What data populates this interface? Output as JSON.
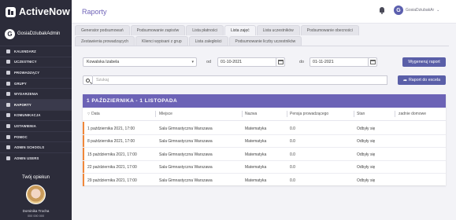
{
  "app": {
    "name": "ActiveNow"
  },
  "sidebar": {
    "user_name": "GosiaDziubakAdmin",
    "user_initial": "G",
    "items": [
      {
        "label": "KALENDARZ",
        "icon": "calendar-icon"
      },
      {
        "label": "UCZESTNICY",
        "icon": "user-icon"
      },
      {
        "label": "PROWADZĄCY",
        "icon": "user-icon"
      },
      {
        "label": "GRUPY",
        "icon": "users-icon"
      },
      {
        "label": "WYDARZENIA",
        "icon": "event-icon"
      },
      {
        "label": "RAPORTY",
        "icon": "chart-icon"
      },
      {
        "label": "KOMUNIKACJA",
        "icon": "message-icon"
      },
      {
        "label": "USTAWIENIA",
        "icon": "gear-icon"
      },
      {
        "label": "POMOC",
        "icon": "help-icon"
      },
      {
        "label": "ADMIN SCHOOLS",
        "icon": "school-icon"
      },
      {
        "label": "ADMIN USERS",
        "icon": "admin-icon"
      }
    ],
    "active_index": 5,
    "opiekun": {
      "title": "Twój opiekun",
      "name": "Dominika Trocha",
      "phone": "000 000 000"
    }
  },
  "header": {
    "title": "Raporty",
    "user_name": "GosiaDziubakAr",
    "user_initial": "G",
    "chevron": "⌄"
  },
  "tabs": {
    "row1": [
      "Generator podsumowań",
      "Podsumowanie zapisów",
      "Lista płatności",
      "Lista zajęć",
      "Lista uczestników",
      "Podsumowanie obecności"
    ],
    "row2": [
      "Zestawienia prowadzących",
      "Klienci wypisani z grup",
      "Lista zaległości",
      "Podsumowanie liczby uczestników"
    ],
    "active": "Lista zajęć"
  },
  "filters": {
    "instructor": "Kowalska Izabela",
    "from_label": "od",
    "from_date": "01-10-2021",
    "to_label": "do",
    "to_date": "01-11-2021",
    "generate_label": "Wygeneruj raport"
  },
  "search": {
    "placeholder": "Szukaj",
    "export_label": "Raport do excela"
  },
  "table": {
    "period": "1 PAŹDZIERNIKA - 1 LISTOPADA",
    "columns": [
      "Data",
      "Miejsce",
      "Nazwa",
      "Pensja prowadzącego",
      "Stan",
      "zadnie domowe"
    ],
    "rows": [
      {
        "date": "1 października 2021, 17:00",
        "place": "Sala Gimnastyczna Warszawa",
        "name": "Matematyka",
        "salary": "0.0",
        "status": "Odbyły się",
        "homework": ""
      },
      {
        "date": "8 października 2021, 17:00",
        "place": "Sala Gimnastyczna Warszawa",
        "name": "Matematyka",
        "salary": "0.0",
        "status": "Odbyły się",
        "homework": ""
      },
      {
        "date": "15 października 2021, 17:00",
        "place": "Sala Gimnastyczna Warszawa",
        "name": "Matematyka",
        "salary": "0.0",
        "status": "Odbyły się",
        "homework": ""
      },
      {
        "date": "22 października 2021, 17:00",
        "place": "Sala Gimnastyczna Warszawa",
        "name": "Matematyka",
        "salary": "0.0",
        "status": "Odbyły się",
        "homework": ""
      },
      {
        "date": "29 października 2021, 17:00",
        "place": "Sala Gimnastyczna Warszawa",
        "name": "Matematyka",
        "salary": "0.0",
        "status": "Odbyły się",
        "homework": ""
      }
    ]
  },
  "colors": {
    "sidebar_bg": "#2c2c3a",
    "accent": "#6c63b6",
    "button": "#5a5fa8",
    "row_marker": "#f0873a"
  }
}
